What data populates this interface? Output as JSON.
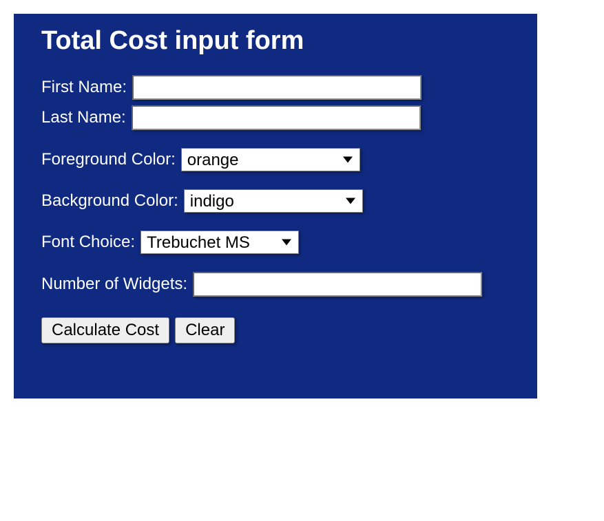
{
  "form": {
    "title": "Total Cost input form",
    "fields": {
      "first_name": {
        "label": "First Name:",
        "value": ""
      },
      "last_name": {
        "label": "Last Name:",
        "value": ""
      },
      "foreground_color": {
        "label": "Foreground Color:",
        "selected": "orange"
      },
      "background_color": {
        "label": "Background Color:",
        "selected": "indigo"
      },
      "font_choice": {
        "label": "Font Choice:",
        "selected": "Trebuchet MS"
      },
      "widgets": {
        "label": "Number of Widgets:",
        "value": ""
      }
    },
    "buttons": {
      "calculate": "Calculate Cost",
      "clear": "Clear"
    }
  }
}
